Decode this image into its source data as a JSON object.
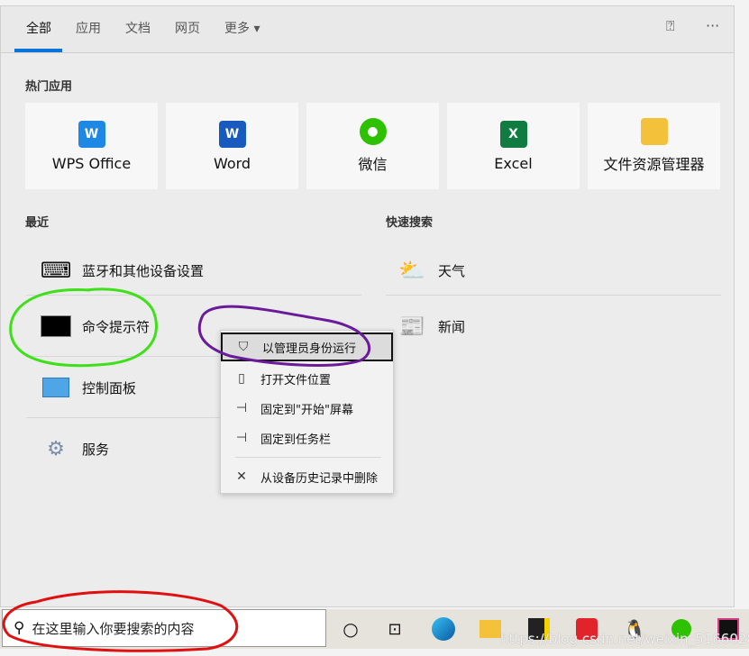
{
  "tabs": [
    {
      "label": "全部"
    },
    {
      "label": "应用"
    },
    {
      "label": "文档"
    },
    {
      "label": "网页"
    },
    {
      "label": "更多 ▾"
    }
  ],
  "top_icons": [
    "feedback-icon",
    "more-icon"
  ],
  "top_more": "···",
  "hot_apps": {
    "title": "热门应用",
    "items": [
      {
        "label": "WPS Office",
        "icon": "W",
        "color": "#1e88e5"
      },
      {
        "label": "Word",
        "icon": "W",
        "color": "#185abd"
      },
      {
        "label": "微信",
        "icon": "●",
        "color": "#2dc100"
      },
      {
        "label": "Excel",
        "icon": "X",
        "color": "#107c41"
      },
      {
        "label": "文件资源管理器",
        "icon": "▬",
        "color": "#f3c13a"
      }
    ]
  },
  "recent": {
    "title": "最近",
    "items": [
      {
        "label": "蓝牙和其他设备设置"
      },
      {
        "label": "命令提示符"
      },
      {
        "label": "控制面板"
      },
      {
        "label": "服务"
      }
    ]
  },
  "quick": {
    "title": "快速搜索",
    "items": [
      {
        "label": "天气"
      },
      {
        "label": "新闻"
      }
    ]
  },
  "context_menu": [
    {
      "label": "以管理员身份运行",
      "icon": "🛡"
    },
    {
      "label": "打开文件位置",
      "icon": "▯"
    },
    {
      "label": "固定到\"开始\"屏幕",
      "icon": "⊣"
    },
    {
      "label": "固定到任务栏",
      "icon": "⊣"
    },
    {
      "label": "从设备历史记录中删除",
      "icon": "✕"
    }
  ],
  "search": {
    "placeholder": "在这里输入你要搜索的内容"
  },
  "watermark": "https://blog.csdn.net/weixin_51660283",
  "accent": "#0a74d8"
}
